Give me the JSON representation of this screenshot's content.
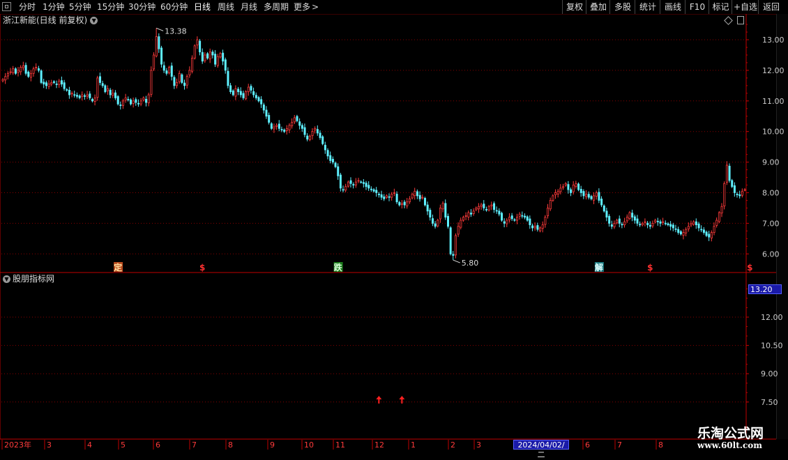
{
  "toolbar": {
    "periods": [
      "分时",
      "1分钟",
      "5分钟",
      "15分钟",
      "30分钟",
      "60分钟",
      "日线",
      "周线",
      "月线",
      "多周期",
      "更多"
    ],
    "active_period": "日线",
    "more_arrow": ">",
    "right_buttons": [
      "复权",
      "叠加",
      "多股",
      "统计",
      "画线",
      "F10",
      "标记",
      "+自选",
      "返回"
    ]
  },
  "main_panel": {
    "title": "浙江新能(日线 前复权)",
    "high_label": "13.38",
    "low_label": "5.80"
  },
  "sub_panel": {
    "title": "股朋指标网",
    "current_value": "13.20"
  },
  "signals": [
    {
      "text": "定",
      "idx": 45,
      "bg": "#b84a1e",
      "color": "#ffe0a0"
    },
    {
      "text": "$",
      "idx": 78,
      "bg": "",
      "color": "#ff3030"
    },
    {
      "text": "跌",
      "idx": 131,
      "bg": "#1b7a1b",
      "color": "#d8ffd8"
    },
    {
      "text": "解",
      "idx": 233,
      "bg": "#1a7a80",
      "color": "#e0ffff"
    },
    {
      "text": "$",
      "idx": 253,
      "bg": "",
      "color": "#ff3030"
    },
    {
      "text": "$",
      "idx": 292,
      "bg": "",
      "color": "#ff3030"
    }
  ],
  "arrows_idx": [
    147,
    156
  ],
  "date_axis": {
    "labels": [
      "2023年",
      "3",
      "4",
      "5",
      "6",
      "7",
      "8",
      "9",
      "10",
      "11",
      "12",
      "1",
      "2",
      "3",
      "6",
      "7",
      "8"
    ],
    "highlight": "2024/04/02/二"
  },
  "watermark": {
    "title": "乐淘公式网",
    "url": "www.60lt.com"
  },
  "colors": {
    "up": "#ff3b3b",
    "down": "#5ef0ff",
    "axis": "#c00000",
    "grid": "#8a0000",
    "text": "#cccccc"
  },
  "chart_data": [
    {
      "type": "candlestick",
      "title": "浙江新能(日线 前复权)",
      "ylim": [
        5.6,
        13.6
      ],
      "yticks": [
        6.0,
        7.0,
        8.0,
        9.0,
        10.0,
        11.0,
        12.0,
        13.0
      ],
      "period": "2023-02 to 2024-08",
      "close_series": [
        11.7,
        11.8,
        11.9,
        11.95,
        12.05,
        11.9,
        12.0,
        12.1,
        12.15,
        11.9,
        11.8,
        11.9,
        12.05,
        12.1,
        12.0,
        11.6,
        11.55,
        11.5,
        11.55,
        11.6,
        11.6,
        11.55,
        11.65,
        11.55,
        11.4,
        11.35,
        11.2,
        11.25,
        11.2,
        11.15,
        11.1,
        11.2,
        11.15,
        11.2,
        11.1,
        11.0,
        11.1,
        11.75,
        11.6,
        11.5,
        11.3,
        11.4,
        11.2,
        11.25,
        11.1,
        10.9,
        10.85,
        11.0,
        11.1,
        11.05,
        10.9,
        11.0,
        10.95,
        10.9,
        11.0,
        11.1,
        10.95,
        11.2,
        12.0,
        12.5,
        13.1,
        12.7,
        12.2,
        12.0,
        11.9,
        12.1,
        11.8,
        11.5,
        11.6,
        11.9,
        11.6,
        11.5,
        11.8,
        12.0,
        12.4,
        12.8,
        13.0,
        12.6,
        12.3,
        12.5,
        12.4,
        12.6,
        12.5,
        12.2,
        12.45,
        12.55,
        12.3,
        12.0,
        11.5,
        11.3,
        11.2,
        11.4,
        11.3,
        11.2,
        11.1,
        11.3,
        11.45,
        11.35,
        11.2,
        11.1,
        11.0,
        10.9,
        10.7,
        10.5,
        10.3,
        10.1,
        10.15,
        10.2,
        10.1,
        10.05,
        10.0,
        10.1,
        10.2,
        10.3,
        10.45,
        10.35,
        10.2,
        10.1,
        9.9,
        9.75,
        9.85,
        10.0,
        10.1,
        9.95,
        9.8,
        9.6,
        9.4,
        9.2,
        9.05,
        9.0,
        8.85,
        8.55,
        8.15,
        8.1,
        8.2,
        8.35,
        8.3,
        8.25,
        8.35,
        8.4,
        8.35,
        8.3,
        8.2,
        8.15,
        8.1,
        8.05,
        8.0,
        7.95,
        7.85,
        7.8,
        7.9,
        7.85,
        7.95,
        8.0,
        7.7,
        7.6,
        7.65,
        7.6,
        7.7,
        7.8,
        7.95,
        8.05,
        7.9,
        7.8,
        7.85,
        7.6,
        7.4,
        7.2,
        7.0,
        6.9,
        7.1,
        7.5,
        7.65,
        7.2,
        6.9,
        6.0,
        5.95,
        6.6,
        6.9,
        7.1,
        7.2,
        7.25,
        7.35,
        7.3,
        7.4,
        7.5,
        7.55,
        7.6,
        7.5,
        7.45,
        7.55,
        7.6,
        7.45,
        7.4,
        7.3,
        7.1,
        7.0,
        7.1,
        7.2,
        7.15,
        7.1,
        7.2,
        7.3,
        7.25,
        7.2,
        7.1,
        6.95,
        6.85,
        6.9,
        6.8,
        6.85,
        6.95,
        7.2,
        7.5,
        7.75,
        7.9,
        8.0,
        8.05,
        8.15,
        8.2,
        8.3,
        8.1,
        8.0,
        8.25,
        8.3,
        8.1,
        8.0,
        7.9,
        7.95,
        7.85,
        7.8,
        7.9,
        8.0,
        7.75,
        7.6,
        7.4,
        7.2,
        7.0,
        6.9,
        7.0,
        7.1,
        7.0,
        6.95,
        7.05,
        7.2,
        7.35,
        7.2,
        7.1,
        7.0,
        6.95,
        7.0,
        7.05,
        6.95,
        6.9,
        7.0,
        7.1,
        7.05,
        7.0,
        7.05,
        7.0,
        6.95,
        6.9,
        6.85,
        6.8,
        6.7,
        6.65,
        6.7,
        6.8,
        6.9,
        7.0,
        7.05,
        6.95,
        6.85,
        6.8,
        6.7,
        6.6,
        6.55,
        6.7,
        6.9,
        7.1,
        7.35,
        7.55,
        8.3,
        8.9,
        8.4,
        8.2,
        8.0,
        7.95,
        7.9,
        8.05,
        8.1
      ]
    },
    {
      "type": "indicator",
      "title": "股朋指标网",
      "yticks": [
        7.5,
        9.0,
        10.5,
        12.0
      ],
      "current_value": 13.2
    }
  ]
}
